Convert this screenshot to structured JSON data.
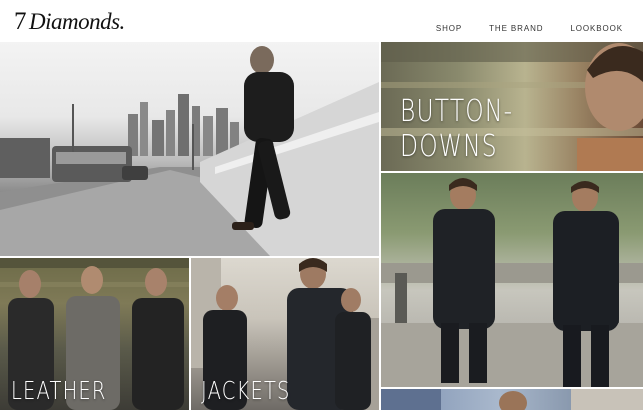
{
  "brand": {
    "number": "7",
    "name": "Diamonds."
  },
  "nav": {
    "items": [
      {
        "label": "SHOP"
      },
      {
        "label": "THE BRAND"
      },
      {
        "label": "LOOKBOOK"
      }
    ]
  },
  "tiles": {
    "city": {
      "label": ""
    },
    "button_downs": {
      "label": "BUTTON-DOWNS"
    },
    "coats": {
      "label": ""
    },
    "leather": {
      "label": "LEATHER"
    },
    "jackets": {
      "label": "JACKETS"
    },
    "more": {
      "label": ""
    }
  }
}
